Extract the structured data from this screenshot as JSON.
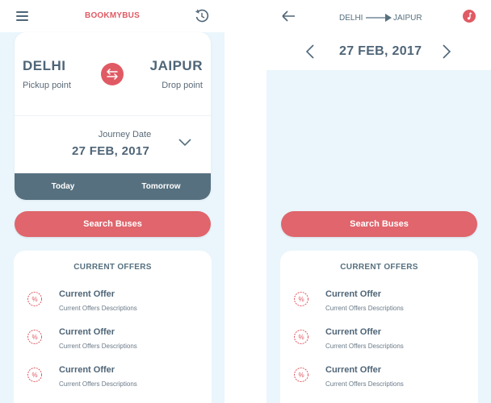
{
  "left": {
    "brand": "BOOKMYBUS",
    "from_city": "DELHI",
    "from_sub": "Pickup point",
    "to_city": "JAIPUR",
    "to_sub": "Drop point",
    "journey_label": "Journey Date",
    "journey_date": "27 FEB, 2017",
    "today": "Today",
    "tomorrow": "Tomorrow",
    "search": "Search Buses",
    "offers_title": "CURRENT OFFERS",
    "offers": [
      {
        "title": "Current Offer",
        "desc": "Current Offers Descriptions"
      },
      {
        "title": "Current Offer",
        "desc": "Current Offers Descriptions"
      },
      {
        "title": "Current Offer",
        "desc": "Current Offers Descriptions"
      }
    ]
  },
  "right": {
    "from": "DELHI",
    "to": "JAIPUR",
    "date": "27 FEB, 2017",
    "search": "Search Buses",
    "offers_title": "CURRENT OFFERS",
    "offers": [
      {
        "title": "Current Offer",
        "desc": "Current Offers Descriptions"
      },
      {
        "title": "Current Offer",
        "desc": "Current Offers Descriptions"
      },
      {
        "title": "Current Offer",
        "desc": "Current Offers Descriptions"
      }
    ]
  },
  "colors": {
    "accent": "#e05a64",
    "slate": "#56707f",
    "background": "#eaf6fc"
  },
  "icons": [
    "menu-icon",
    "history-icon",
    "swap-icon",
    "chevron-down-icon",
    "percent-badge-icon",
    "back-arrow-icon",
    "route-arrow-icon",
    "music-icon",
    "chevron-left-icon",
    "chevron-right-icon"
  ]
}
